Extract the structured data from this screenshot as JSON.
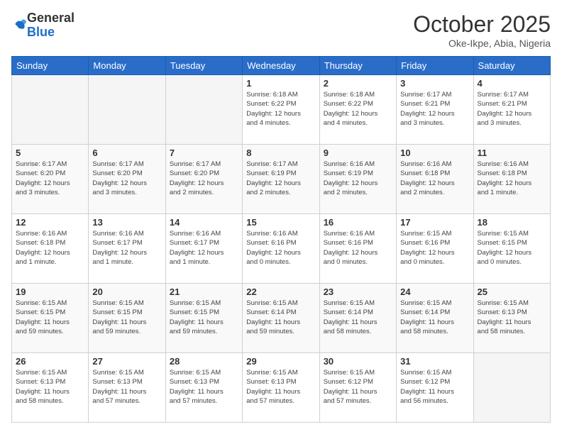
{
  "logo": {
    "general": "General",
    "blue": "Blue"
  },
  "title": "October 2025",
  "location": "Oke-Ikpe, Abia, Nigeria",
  "weekdays": [
    "Sunday",
    "Monday",
    "Tuesday",
    "Wednesday",
    "Thursday",
    "Friday",
    "Saturday"
  ],
  "weeks": [
    [
      {
        "day": "",
        "info": ""
      },
      {
        "day": "",
        "info": ""
      },
      {
        "day": "",
        "info": ""
      },
      {
        "day": "1",
        "info": "Sunrise: 6:18 AM\nSunset: 6:22 PM\nDaylight: 12 hours\nand 4 minutes."
      },
      {
        "day": "2",
        "info": "Sunrise: 6:18 AM\nSunset: 6:22 PM\nDaylight: 12 hours\nand 4 minutes."
      },
      {
        "day": "3",
        "info": "Sunrise: 6:17 AM\nSunset: 6:21 PM\nDaylight: 12 hours\nand 3 minutes."
      },
      {
        "day": "4",
        "info": "Sunrise: 6:17 AM\nSunset: 6:21 PM\nDaylight: 12 hours\nand 3 minutes."
      }
    ],
    [
      {
        "day": "5",
        "info": "Sunrise: 6:17 AM\nSunset: 6:20 PM\nDaylight: 12 hours\nand 3 minutes."
      },
      {
        "day": "6",
        "info": "Sunrise: 6:17 AM\nSunset: 6:20 PM\nDaylight: 12 hours\nand 3 minutes."
      },
      {
        "day": "7",
        "info": "Sunrise: 6:17 AM\nSunset: 6:20 PM\nDaylight: 12 hours\nand 2 minutes."
      },
      {
        "day": "8",
        "info": "Sunrise: 6:17 AM\nSunset: 6:19 PM\nDaylight: 12 hours\nand 2 minutes."
      },
      {
        "day": "9",
        "info": "Sunrise: 6:16 AM\nSunset: 6:19 PM\nDaylight: 12 hours\nand 2 minutes."
      },
      {
        "day": "10",
        "info": "Sunrise: 6:16 AM\nSunset: 6:18 PM\nDaylight: 12 hours\nand 2 minutes."
      },
      {
        "day": "11",
        "info": "Sunrise: 6:16 AM\nSunset: 6:18 PM\nDaylight: 12 hours\nand 1 minute."
      }
    ],
    [
      {
        "day": "12",
        "info": "Sunrise: 6:16 AM\nSunset: 6:18 PM\nDaylight: 12 hours\nand 1 minute."
      },
      {
        "day": "13",
        "info": "Sunrise: 6:16 AM\nSunset: 6:17 PM\nDaylight: 12 hours\nand 1 minute."
      },
      {
        "day": "14",
        "info": "Sunrise: 6:16 AM\nSunset: 6:17 PM\nDaylight: 12 hours\nand 1 minute."
      },
      {
        "day": "15",
        "info": "Sunrise: 6:16 AM\nSunset: 6:16 PM\nDaylight: 12 hours\nand 0 minutes."
      },
      {
        "day": "16",
        "info": "Sunrise: 6:16 AM\nSunset: 6:16 PM\nDaylight: 12 hours\nand 0 minutes."
      },
      {
        "day": "17",
        "info": "Sunrise: 6:15 AM\nSunset: 6:16 PM\nDaylight: 12 hours\nand 0 minutes."
      },
      {
        "day": "18",
        "info": "Sunrise: 6:15 AM\nSunset: 6:15 PM\nDaylight: 12 hours\nand 0 minutes."
      }
    ],
    [
      {
        "day": "19",
        "info": "Sunrise: 6:15 AM\nSunset: 6:15 PM\nDaylight: 11 hours\nand 59 minutes."
      },
      {
        "day": "20",
        "info": "Sunrise: 6:15 AM\nSunset: 6:15 PM\nDaylight: 11 hours\nand 59 minutes."
      },
      {
        "day": "21",
        "info": "Sunrise: 6:15 AM\nSunset: 6:15 PM\nDaylight: 11 hours\nand 59 minutes."
      },
      {
        "day": "22",
        "info": "Sunrise: 6:15 AM\nSunset: 6:14 PM\nDaylight: 11 hours\nand 59 minutes."
      },
      {
        "day": "23",
        "info": "Sunrise: 6:15 AM\nSunset: 6:14 PM\nDaylight: 11 hours\nand 58 minutes."
      },
      {
        "day": "24",
        "info": "Sunrise: 6:15 AM\nSunset: 6:14 PM\nDaylight: 11 hours\nand 58 minutes."
      },
      {
        "day": "25",
        "info": "Sunrise: 6:15 AM\nSunset: 6:13 PM\nDaylight: 11 hours\nand 58 minutes."
      }
    ],
    [
      {
        "day": "26",
        "info": "Sunrise: 6:15 AM\nSunset: 6:13 PM\nDaylight: 11 hours\nand 58 minutes."
      },
      {
        "day": "27",
        "info": "Sunrise: 6:15 AM\nSunset: 6:13 PM\nDaylight: 11 hours\nand 57 minutes."
      },
      {
        "day": "28",
        "info": "Sunrise: 6:15 AM\nSunset: 6:13 PM\nDaylight: 11 hours\nand 57 minutes."
      },
      {
        "day": "29",
        "info": "Sunrise: 6:15 AM\nSunset: 6:13 PM\nDaylight: 11 hours\nand 57 minutes."
      },
      {
        "day": "30",
        "info": "Sunrise: 6:15 AM\nSunset: 6:12 PM\nDaylight: 11 hours\nand 57 minutes."
      },
      {
        "day": "31",
        "info": "Sunrise: 6:15 AM\nSunset: 6:12 PM\nDaylight: 11 hours\nand 56 minutes."
      },
      {
        "day": "",
        "info": ""
      }
    ]
  ]
}
